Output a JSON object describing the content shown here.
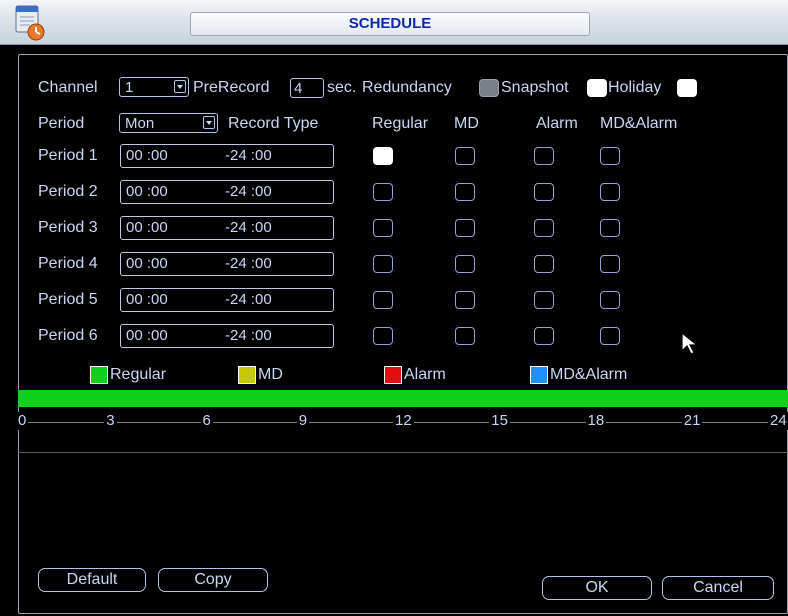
{
  "window": {
    "title": "SCHEDULE"
  },
  "top": {
    "channel_label": "Channel",
    "channel_value": "1",
    "prerecord_label": "PreRecord",
    "prerecord_value": "4",
    "sec_label": "sec.",
    "redundancy_label": "Redundancy",
    "snapshot_label": "Snapshot",
    "holiday_label": "Holiday"
  },
  "period_row": {
    "label": "Period",
    "day_value": "Mon",
    "record_type_label": "Record Type",
    "col_regular": "Regular",
    "col_md": "MD",
    "col_alarm": "Alarm",
    "col_mdalarm": "MD&Alarm"
  },
  "periods": [
    {
      "label": "Period 1",
      "start": "00 :00",
      "end": "-24 :00",
      "regular": true,
      "md": false,
      "alarm": false,
      "mdalarm": false
    },
    {
      "label": "Period 2",
      "start": "00 :00",
      "end": "-24 :00",
      "regular": false,
      "md": false,
      "alarm": false,
      "mdalarm": false
    },
    {
      "label": "Period 3",
      "start": "00 :00",
      "end": "-24 :00",
      "regular": false,
      "md": false,
      "alarm": false,
      "mdalarm": false
    },
    {
      "label": "Period 4",
      "start": "00 :00",
      "end": "-24 :00",
      "regular": false,
      "md": false,
      "alarm": false,
      "mdalarm": false
    },
    {
      "label": "Period 5",
      "start": "00 :00",
      "end": "-24 :00",
      "regular": false,
      "md": false,
      "alarm": false,
      "mdalarm": false
    },
    {
      "label": "Period 6",
      "start": "00 :00",
      "end": "-24 :00",
      "regular": false,
      "md": false,
      "alarm": false,
      "mdalarm": false
    }
  ],
  "legend": {
    "regular": {
      "label": "Regular",
      "color": "#0fd01a"
    },
    "md": {
      "label": "MD",
      "color": "#c8c800"
    },
    "alarm": {
      "label": "Alarm",
      "color": "#e01010"
    },
    "mdalarm": {
      "label": "MD&Alarm",
      "color": "#1e90ff"
    }
  },
  "timeline": {
    "ticks": [
      "0",
      "3",
      "6",
      "9",
      "12",
      "15",
      "18",
      "21",
      "24"
    ],
    "regular_range": [
      0,
      24
    ]
  },
  "buttons": {
    "default": "Default",
    "copy": "Copy",
    "ok": "OK",
    "cancel": "Cancel"
  }
}
